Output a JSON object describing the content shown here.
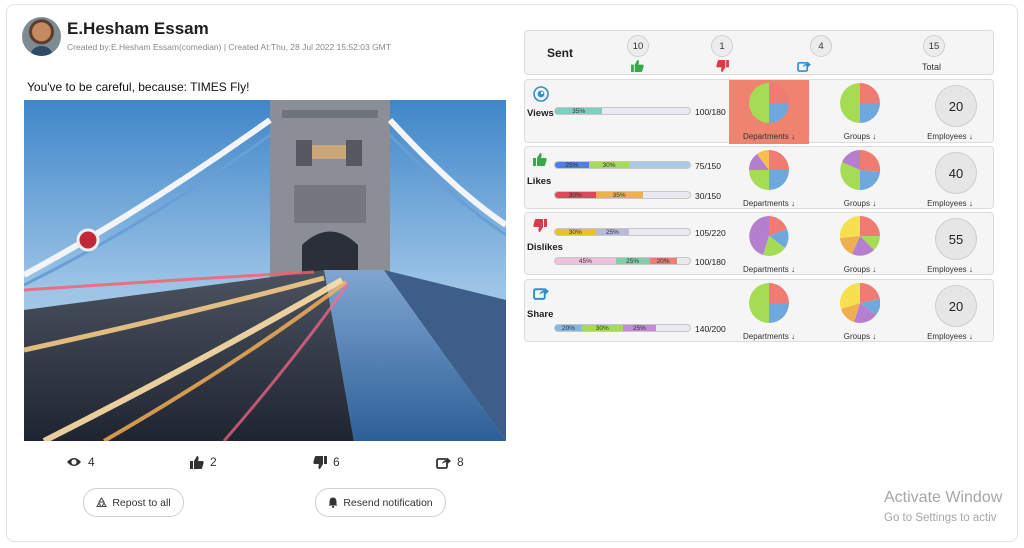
{
  "post": {
    "author": "E.Hesham Essam",
    "meta": "Created by:E.Hesham Essam(comedian) | Created At:Thu, 28 Jul 2022 15:52:03 GMT",
    "text": "You've to be careful, because: TIMES Fly!",
    "image_alt": "Tower Bridge at dusk with light trails",
    "stats": {
      "views": "4",
      "likes": "2",
      "dislikes": "6",
      "shares": "8"
    },
    "buttons": {
      "repost": "Repost to all",
      "resend": "Resend notification"
    }
  },
  "sent": {
    "label": "Sent",
    "likes": "10",
    "dislikes": "1",
    "shares": "4",
    "total": "15",
    "total_label": "Total"
  },
  "rows": {
    "views": {
      "label": "Views",
      "bars": [
        {
          "ratio": "100/180",
          "segments": [
            {
              "label": "35%",
              "value": 35,
              "color": "#7fcfc0"
            }
          ]
        }
      ],
      "employees": "20"
    },
    "likes": {
      "label": "Likes",
      "bars": [
        {
          "ratio": "75/150",
          "segments": [
            {
              "label": "25%",
              "value": 25,
              "color": "#4f7de8"
            },
            {
              "label": "30%",
              "value": 30,
              "color": "#a6dc54"
            }
          ]
        },
        {
          "ratio": "30/150",
          "segments": [
            {
              "label": "30%",
              "value": 30,
              "color": "#e0455a"
            },
            {
              "label": "35%",
              "value": 35,
              "color": "#eeaf4f"
            }
          ]
        }
      ],
      "employees": "40"
    },
    "dislikes": {
      "label": "Dislikes",
      "bars": [
        {
          "ratio": "105/220",
          "segments": [
            {
              "label": "30%",
              "value": 30,
              "color": "#e9c02e"
            },
            {
              "label": "25%",
              "value": 25,
              "color": "#b9b9dc"
            }
          ]
        },
        {
          "ratio": "100/180",
          "segments": [
            {
              "label": "45%",
              "value": 45,
              "color": "#f1bfdc"
            },
            {
              "label": "25%",
              "value": 25,
              "color": "#7fcfaa"
            },
            {
              "label": "20%",
              "value": 20,
              "color": "#ef7d76"
            }
          ]
        }
      ],
      "employees": "55"
    },
    "share": {
      "label": "Share",
      "bars": [
        {
          "ratio": "140/200",
          "segments": [
            {
              "label": "20%",
              "value": 20,
              "color": "#87b6e2"
            },
            {
              "label": "30%",
              "value": 30,
              "color": "#a6dc54"
            },
            {
              "label": "25%",
              "value": 25,
              "color": "#c58bd6"
            }
          ]
        }
      ],
      "employees": "20"
    }
  },
  "captions": {
    "departments": "Departments",
    "groups": "Groups",
    "employees": "Employees"
  },
  "watermark": {
    "title": "Activate Window",
    "subtitle": "Go to Settings to activ"
  },
  "colors": {
    "highlight": "#ee8370",
    "pie_red": "#f07b72",
    "pie_blue": "#6fa8dc",
    "pie_green": "#a6dc54",
    "pie_purple": "#b57fcf",
    "pie_orange": "#eeaf4f",
    "pie_yellow": "#f5e04d",
    "like": "#3aa84a",
    "dislike": "#e03a4a",
    "share": "#2f8fcf"
  }
}
